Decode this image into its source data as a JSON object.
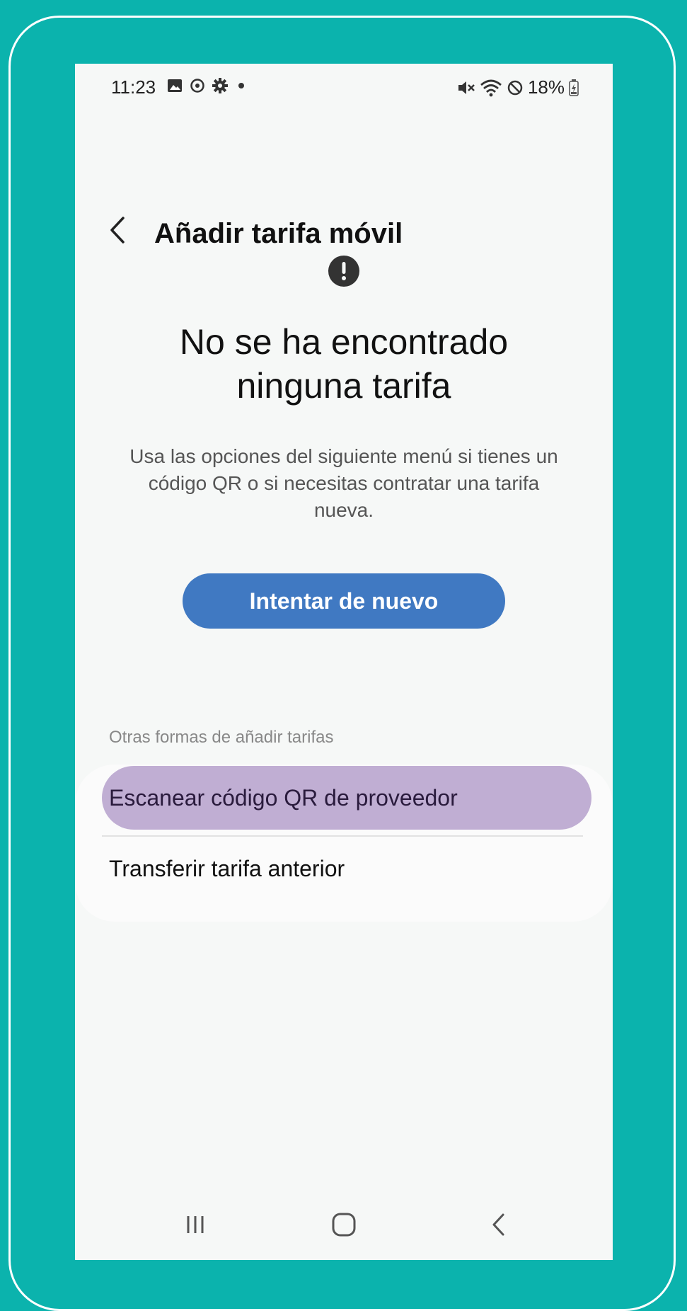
{
  "status_bar": {
    "time": "11:23",
    "battery": "18%",
    "icons_left": [
      "image-icon",
      "sync-icon",
      "gear-icon",
      "dot-icon"
    ],
    "icons_right": [
      "mute-icon",
      "wifi-icon",
      "block-icon",
      "battery-icon"
    ]
  },
  "header": {
    "title": "Añadir tarifa móvil"
  },
  "main": {
    "heading": "No se ha encontrado ninguna tarifa",
    "description": "Usa las opciones del siguiente menú si tienes un código QR o si necesitas contratar una tarifa nueva.",
    "retry_label": "Intentar de nuevo"
  },
  "options": {
    "section_label": "Otras formas de añadir tarifas",
    "items": [
      {
        "label": "Escanear código QR de proveedor",
        "selected": true
      },
      {
        "label": "Transferir tarifa anterior",
        "selected": false
      }
    ]
  },
  "colors": {
    "background": "#0bb3ad",
    "screen": "#f6f8f7",
    "accent": "#4079c2",
    "highlight": "#c0aed3"
  }
}
